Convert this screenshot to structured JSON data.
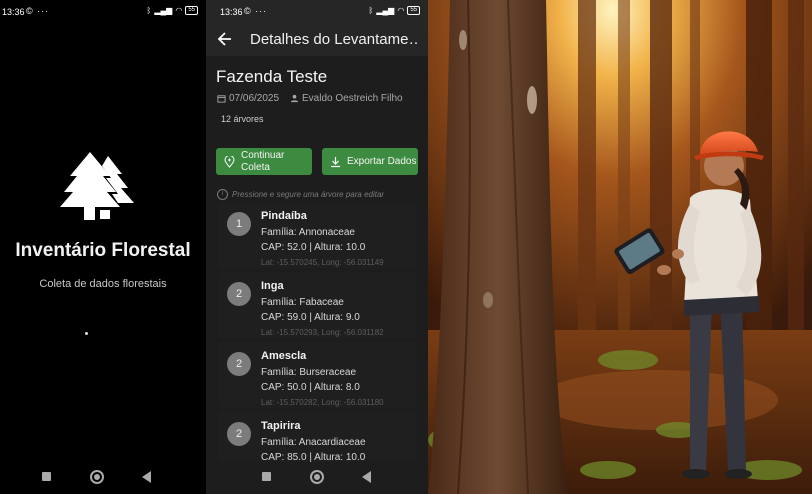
{
  "splash": {
    "status": {
      "time": "13:36",
      "left_icons": "© ···",
      "battery": "55"
    },
    "title": "Inventário Florestal",
    "subtitle": "Coleta de dados florestais"
  },
  "details": {
    "status": {
      "time": "13:36",
      "left_icons": "© ···",
      "battery": "55"
    },
    "appbar_title": "Detalhes do Levantame…",
    "survey_name": "Fazenda Teste",
    "date": "07/06/2025",
    "author": "Evaldo Oestreich Filho",
    "tree_count": "12 árvores",
    "continue_button": "Continuar Coleta",
    "export_button": "Exportar Dados",
    "hint": "Pressione e segure uma árvore para editar",
    "trees": [
      {
        "num": "1",
        "name": "Pindaíba",
        "family": "Família: Annonaceae",
        "measures": "CAP: 52.0 | Altura: 10.0",
        "coords": "Lat: -15.570245, Long: -56.031149"
      },
      {
        "num": "2",
        "name": "Inga",
        "family": "Família: Fabaceae",
        "measures": "CAP: 59.0 | Altura: 9.0",
        "coords": "Lat: -15.570293, Long: -56.031182"
      },
      {
        "num": "2",
        "name": "Amescla",
        "family": "Família: Burseraceae",
        "measures": "CAP: 50.0 | Altura: 8.0",
        "coords": "Lat: -15.570282, Long: -56.031180"
      },
      {
        "num": "2",
        "name": "Tapirira",
        "family": "Família: Anacardiaceae",
        "measures": "CAP: 85.0 | Altura: 10.0",
        "coords": ""
      }
    ]
  },
  "colors": {
    "accent_green": "#3d8b40",
    "background_dark": "#1d1d1d",
    "helmet_orange": "#e2501f"
  },
  "icons": [
    "tree-logo-icon",
    "back-arrow-icon",
    "calendar-icon",
    "person-icon",
    "add-location-icon",
    "download-icon",
    "info-icon"
  ]
}
